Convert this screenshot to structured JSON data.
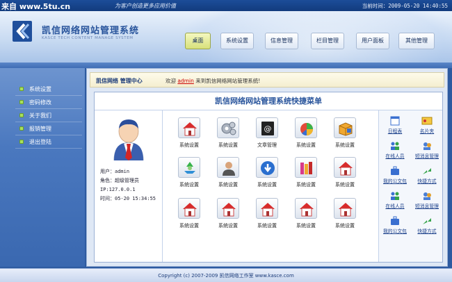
{
  "topbar": {
    "watermark": "来自 www.5tu.cn",
    "slogan": "为客户创造更多应用价值",
    "clock": "当前时间：2009-05-20 14:40:55"
  },
  "header": {
    "title": "凯信网络网站管理系统",
    "subtitle": "KASCE TECH CONTENT MANAGE SYSTEM",
    "nav": [
      {
        "label": "桌面",
        "active": true
      },
      {
        "label": "系统设置",
        "active": false
      },
      {
        "label": "信息管理",
        "active": false
      },
      {
        "label": "栏目管理",
        "active": false
      },
      {
        "label": "用户面板",
        "active": false
      },
      {
        "label": "其他管理",
        "active": false
      }
    ]
  },
  "sidebar": {
    "items": [
      {
        "label": "系统设置"
      },
      {
        "label": "密码修改"
      },
      {
        "label": "关于我们"
      },
      {
        "label": "报销管理"
      },
      {
        "label": "退出登陆"
      }
    ]
  },
  "breadcrumb": {
    "title": "凯信网络  管理中心",
    "welcome_prefix": "欢迎",
    "username": "admin",
    "welcome_suffix": "来到凯信网络网站管理系统!"
  },
  "content": {
    "title": "凯信网络网站管理系统快捷菜单"
  },
  "user": {
    "account": "用户：admin",
    "role": "角色：超级管理员",
    "ip": "IP:127.0.0.1",
    "time": "时间：05-20 15:34:55"
  },
  "tiles": [
    {
      "label": "系统设置",
      "icon": "house-icon"
    },
    {
      "label": "系统设置",
      "icon": "gears-icon"
    },
    {
      "label": "文章管理",
      "icon": "at-book-icon"
    },
    {
      "label": "系统设置",
      "icon": "pie-chart-icon"
    },
    {
      "label": "系统设置",
      "icon": "box-icon"
    },
    {
      "label": "系统设置",
      "icon": "recycle-icon"
    },
    {
      "label": "系统设置",
      "icon": "user-icon"
    },
    {
      "label": "系统设置",
      "icon": "download-icon"
    },
    {
      "label": "系统设置",
      "icon": "books-icon"
    },
    {
      "label": "系统设置",
      "icon": "house-icon"
    },
    {
      "label": "系统设置",
      "icon": "house-icon"
    },
    {
      "label": "系统设置",
      "icon": "house-icon"
    },
    {
      "label": "系统设置",
      "icon": "house-icon"
    },
    {
      "label": "系统设置",
      "icon": "house-icon"
    },
    {
      "label": "系统设置",
      "icon": "house-icon"
    }
  ],
  "quick": [
    {
      "label": "日程表",
      "icon": "calendar-icon"
    },
    {
      "label": "名片夹",
      "icon": "card-icon"
    },
    {
      "label": "在线人员",
      "icon": "people-icon"
    },
    {
      "label": "短消息管理",
      "icon": "message-icon"
    },
    {
      "label": "我的公文包",
      "icon": "briefcase-icon"
    },
    {
      "label": "快捷方式",
      "icon": "shortcut-icon"
    },
    {
      "label": "在线人员",
      "icon": "people-icon"
    },
    {
      "label": "短消息管理",
      "icon": "message-icon"
    },
    {
      "label": "我的公文包",
      "icon": "briefcase-icon"
    },
    {
      "label": "快捷方式",
      "icon": "shortcut-icon"
    }
  ],
  "footer": {
    "text": "Copyright (c) 2007-2009  凯信网络工作室  www.kasce.com"
  },
  "colors": {
    "primary": "#2d5aa0",
    "accent": "#a8e060",
    "title": "#27539b"
  }
}
